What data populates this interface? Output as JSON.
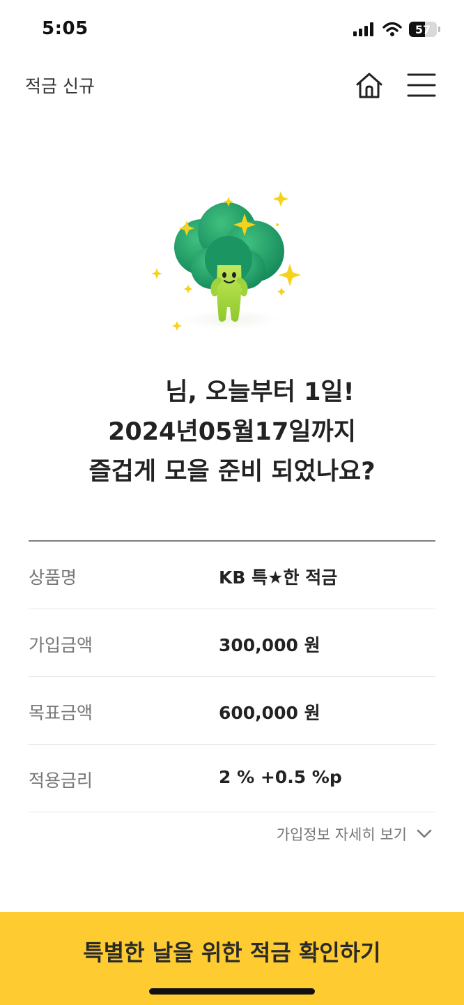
{
  "status_bar": {
    "time": "5:05",
    "battery_level": "57",
    "icons": [
      "signal-icon",
      "wifi-icon",
      "battery-icon"
    ]
  },
  "header": {
    "title": "적금 신규",
    "home_icon": "home-icon",
    "menu_icon": "hamburger-menu-icon"
  },
  "hero": {
    "illustration": "broccoli-mascot",
    "line1": "님, 오늘부터 1일!",
    "line2": "2024년05월17일까지",
    "line3": "즐겁게 모을 준비 되었나요?"
  },
  "info": {
    "rows": [
      {
        "label": "상품명",
        "value": "KB 특★한 적금"
      },
      {
        "label": "가입금액",
        "value": "300,000 원"
      },
      {
        "label": "목표금액",
        "value": "600,000 원"
      },
      {
        "label": "적용금리",
        "value": "2 % +0.5 %p"
      }
    ],
    "detail_link": "가입정보 자세히 보기"
  },
  "cta": {
    "label": "특별한 날을 위한 적금 확인하기"
  },
  "colors": {
    "accent": "#fecc30",
    "divider": "#e5e5e5",
    "mascot_green": "#1f9a63",
    "mascot_body": "#a6d93b"
  }
}
